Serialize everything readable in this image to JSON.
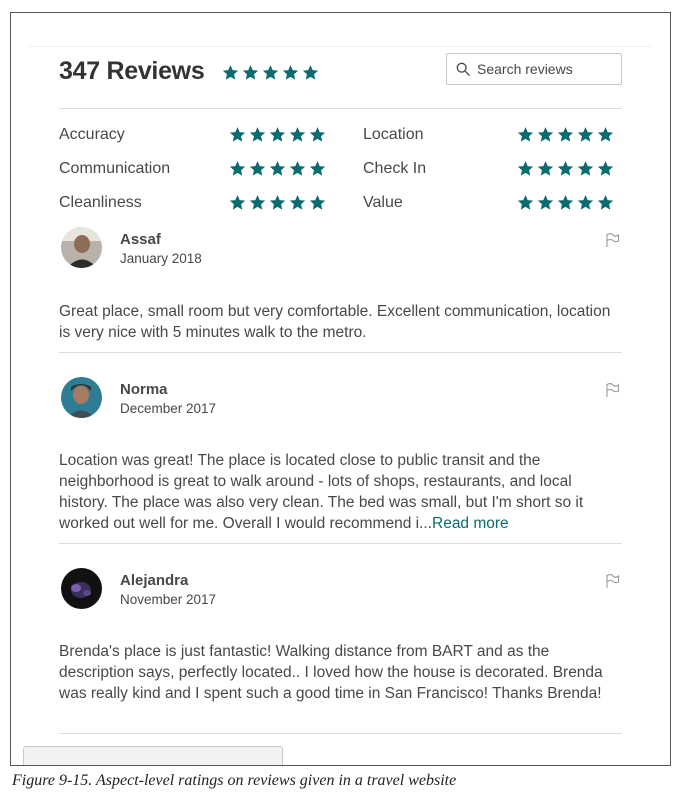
{
  "header": {
    "title": "347 Reviews",
    "overall_rating": 5,
    "overall_rating_max": 5
  },
  "search": {
    "placeholder": "Search reviews",
    "icon": "search-icon"
  },
  "aspects": [
    {
      "label": "Accuracy",
      "rating": 5
    },
    {
      "label": "Location",
      "rating": 5
    },
    {
      "label": "Communication",
      "rating": 5
    },
    {
      "label": "Check In",
      "rating": 5
    },
    {
      "label": "Cleanliness",
      "rating": 5
    },
    {
      "label": "Value",
      "rating": 5
    }
  ],
  "reviews": [
    {
      "name": "Assaf",
      "date": "January 2018",
      "text": "Great place, small room but very comfortable. Excellent communication, location is very nice with 5 minutes walk to the metro.",
      "read_more": ""
    },
    {
      "name": "Norma",
      "date": "December 2017",
      "text": "Location was great! The place is located close to public transit and the neighborhood is great to walk around - lots of shops, restaurants, and local history. The place was also very clean. The bed was small, but I'm short so it worked out well for me. Overall I would recommend i...",
      "read_more": "Read more"
    },
    {
      "name": "Alejandra",
      "date": "November 2017",
      "text": "Brenda's place is just fantastic! Walking distance from BART and as the description says, perfectly located.. I loved how the house is decorated. Brenda was really kind and I spent such a good time in San Francisco! Thanks Brenda!",
      "read_more": ""
    }
  ],
  "caption": "Figure 9-15. Aspect-level ratings on reviews given in a travel website",
  "colors": {
    "accent": "#0b6b6f",
    "text": "#484848",
    "divider": "#dcdcdc"
  },
  "icons": {
    "star": "star-icon",
    "flag": "flag-icon"
  }
}
